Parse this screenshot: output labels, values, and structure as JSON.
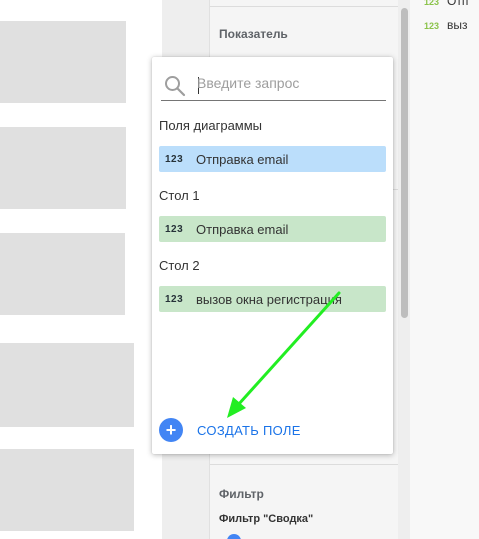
{
  "panel": {
    "metric_title": "Показатель",
    "filter_title": "Фильтр",
    "filter_sub": "Фильтр \"Сводка\""
  },
  "right_list": [
    {
      "icon": "123",
      "label": "Отп"
    },
    {
      "icon": "123",
      "label": "выз"
    }
  ],
  "dropdown": {
    "search_placeholder": "Введите запрос",
    "sections": [
      {
        "title": "Поля диаграммы",
        "fields": [
          {
            "icon": "123",
            "label": "Отправка email"
          }
        ]
      },
      {
        "title": "Стол 1",
        "fields": [
          {
            "icon": "123",
            "label": "Отправка email"
          }
        ]
      },
      {
        "title": "Стол 2",
        "fields": [
          {
            "icon": "123",
            "label": "вызов окна регистрация"
          }
        ]
      }
    ],
    "create_label": "СОЗДАТЬ ПОЛЕ",
    "create_icon": "plus-icon"
  },
  "colors": {
    "chart_field_bg": "#bbdefb",
    "table_field_bg": "#c8e6c9",
    "accent": "#4285f4",
    "annotation_arrow": "#22ee22"
  }
}
